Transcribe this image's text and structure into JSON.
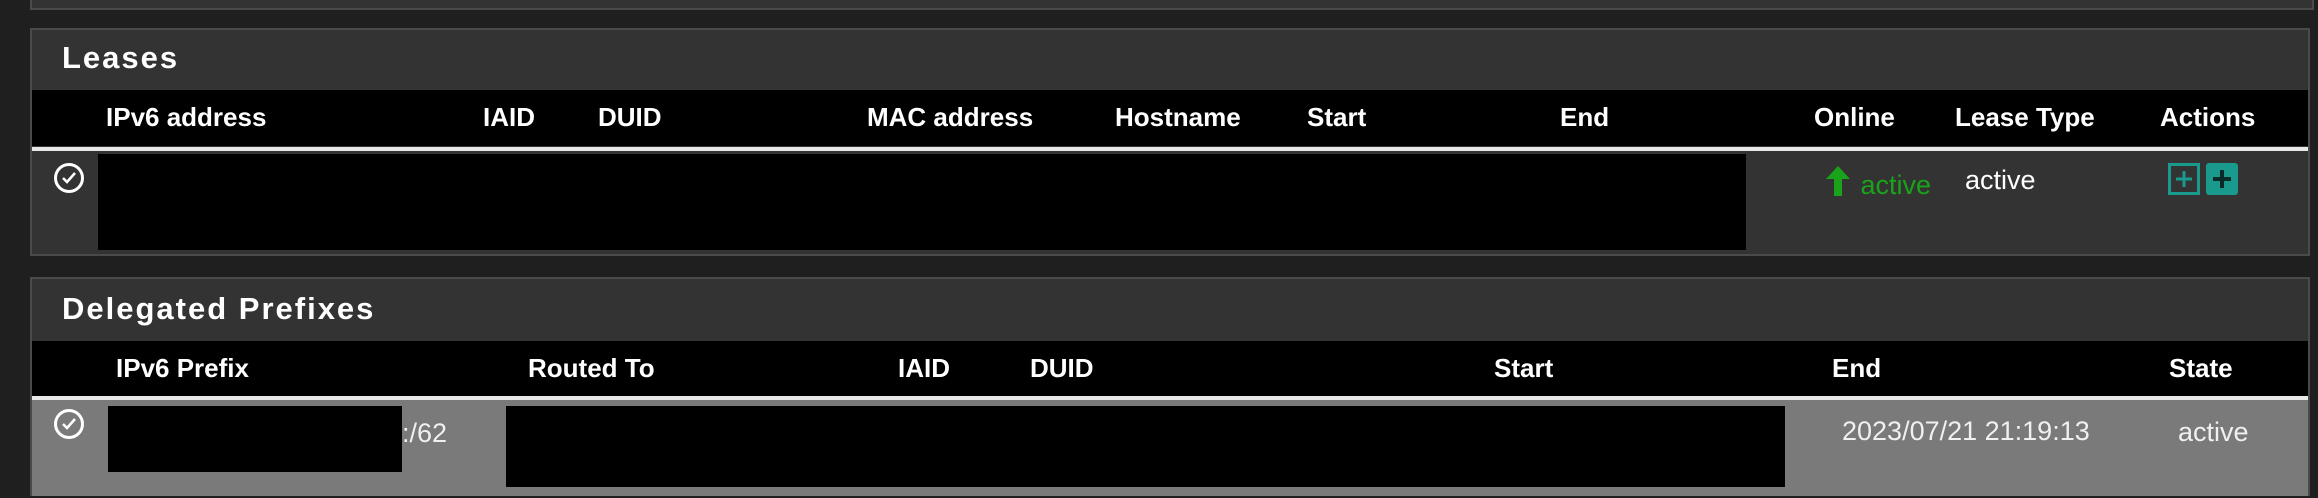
{
  "leases": {
    "title": "Leases",
    "columns": [
      "IPv6 address",
      "IAID",
      "DUID",
      "MAC address",
      "Hostname",
      "Start",
      "End",
      "Online",
      "Lease Type",
      "Actions"
    ],
    "rows": [
      {
        "online_icon": "arrow-up-icon",
        "online": "active",
        "lease_type": "active",
        "actions": [
          "add-static-mapping-icon",
          "add-static-mapping-solid-icon"
        ]
      }
    ]
  },
  "prefixes": {
    "title": "Delegated Prefixes",
    "columns": [
      "IPv6 Prefix",
      "Routed To",
      "IAID",
      "DUID",
      "Start",
      "End",
      "State"
    ],
    "rows": [
      {
        "prefix_suffix": ":/62",
        "end": "2023/07/21 21:19:13",
        "state": "active"
      }
    ]
  },
  "colors": {
    "panel_bg": "#333333",
    "header_bg": "#000000",
    "row_selected_bg": "#7a7a7a",
    "online_green": "#1aa31a",
    "action_teal": "#1a9a8c"
  }
}
